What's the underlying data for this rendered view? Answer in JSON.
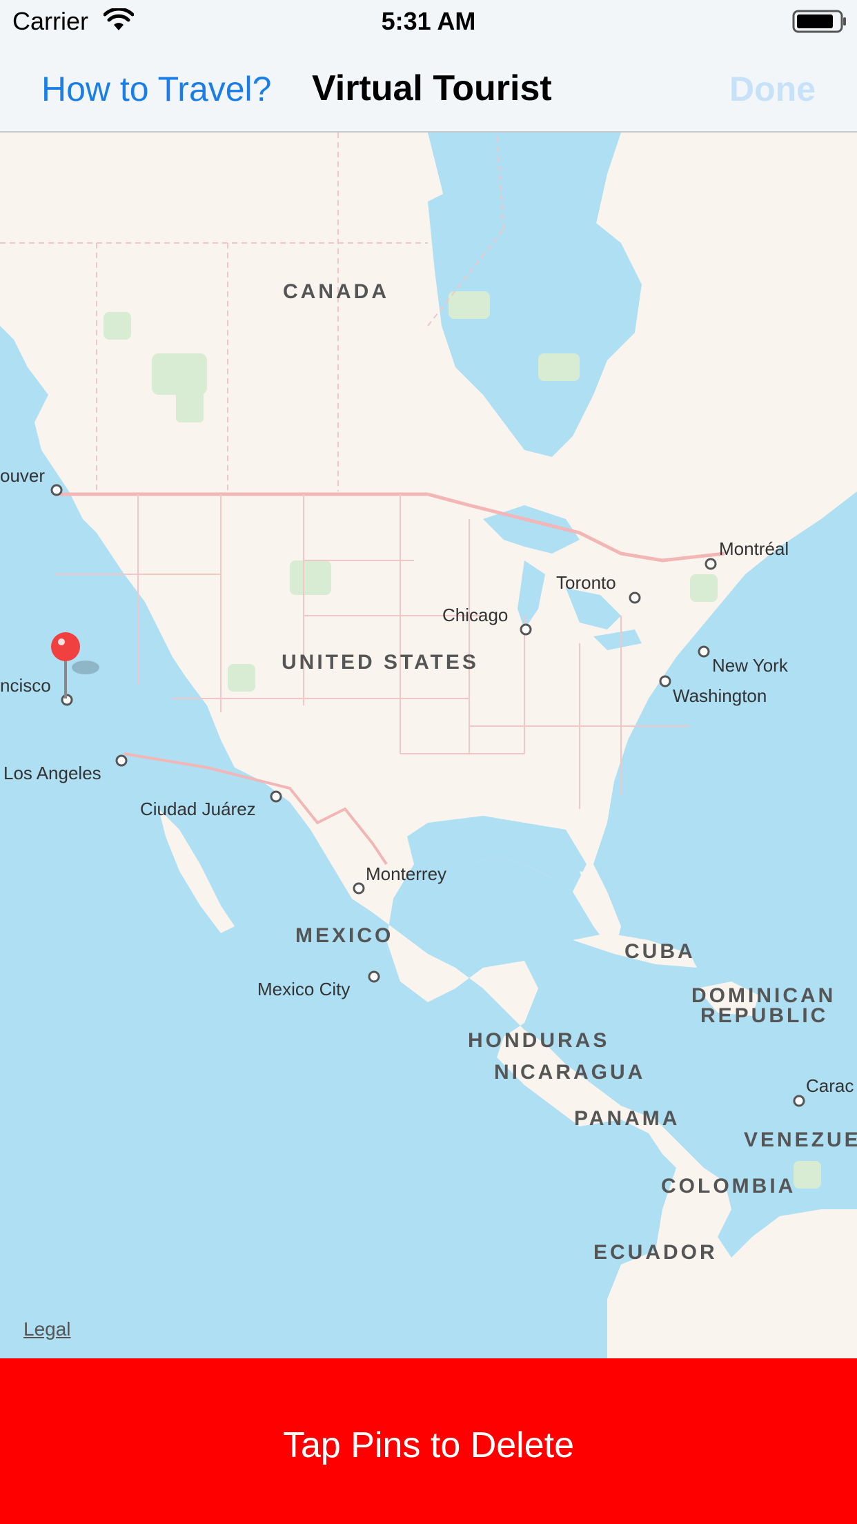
{
  "status_bar": {
    "carrier": "Carrier",
    "time": "5:31 AM"
  },
  "nav": {
    "left_button": "How to Travel?",
    "title": "Virtual Tourist",
    "right_button": "Done"
  },
  "map": {
    "legal": "Legal",
    "countries": {
      "canada": "CANADA",
      "united_states": "UNITED STATES",
      "mexico": "MEXICO",
      "cuba": "CUBA",
      "dominican_1": "DOMINICAN",
      "dominican_2": "REPUBLIC",
      "honduras": "HONDURAS",
      "nicaragua": "NICARAGUA",
      "panama": "PANAMA",
      "venezuela": "VENEZUEL",
      "colombia": "COLOMBIA",
      "ecuador": "ECUADOR"
    },
    "cities": {
      "vancouver": "ouver",
      "montreal": "Montréal",
      "toronto": "Toronto",
      "chicago": "Chicago",
      "new_york": "New York",
      "washington": "Washington",
      "san_francisco": "ncisco",
      "los_angeles": "Los Angeles",
      "ciudad_juarez": "Ciudad Juárez",
      "monterrey": "Monterrey",
      "mexico_city": "Mexico City",
      "caracas": "Carac"
    }
  },
  "bottom": {
    "label": "Tap Pins to Delete"
  },
  "colors": {
    "water": "#aedff3",
    "land": "#f9f5ee",
    "accent_blue": "#1a7ee8",
    "delete_red": "#ff0000",
    "pin_red": "#f04040"
  }
}
